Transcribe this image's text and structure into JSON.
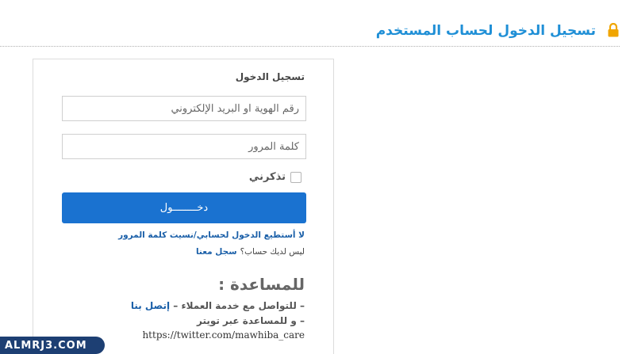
{
  "header": {
    "title": "تسجيل الدخول لحساب المستخدم",
    "icon": "lock-icon",
    "icon_color": "#f0a500",
    "accent_color": "#1f8fd6"
  },
  "login": {
    "title": "تسجيل الدخول",
    "id_placeholder": "رقم الهوية او البريد الإلكتروني",
    "password_placeholder": "كلمة المرور",
    "remember_label": "تذكرني",
    "remember_checked": false,
    "submit_label": "دخــــــــول",
    "button_color": "#1a72d0",
    "cant_login_link": "لا أستطيع الدخول لحسابي/نسيت كلمة المرور",
    "no_account_text": "ليس لديك حساب؟",
    "register_link": "سجل معنا"
  },
  "help": {
    "title": "للمساعدة :",
    "line1_text": "– للتواصل مع خدمة العملاء –",
    "line1_link": "إتصل بنا",
    "line2_text": "– و للمساعدة عبر تويتر",
    "twitter_url": "https://twitter.com/mawhiba_care"
  },
  "watermark": {
    "text": "ALMRJ3.COM"
  }
}
